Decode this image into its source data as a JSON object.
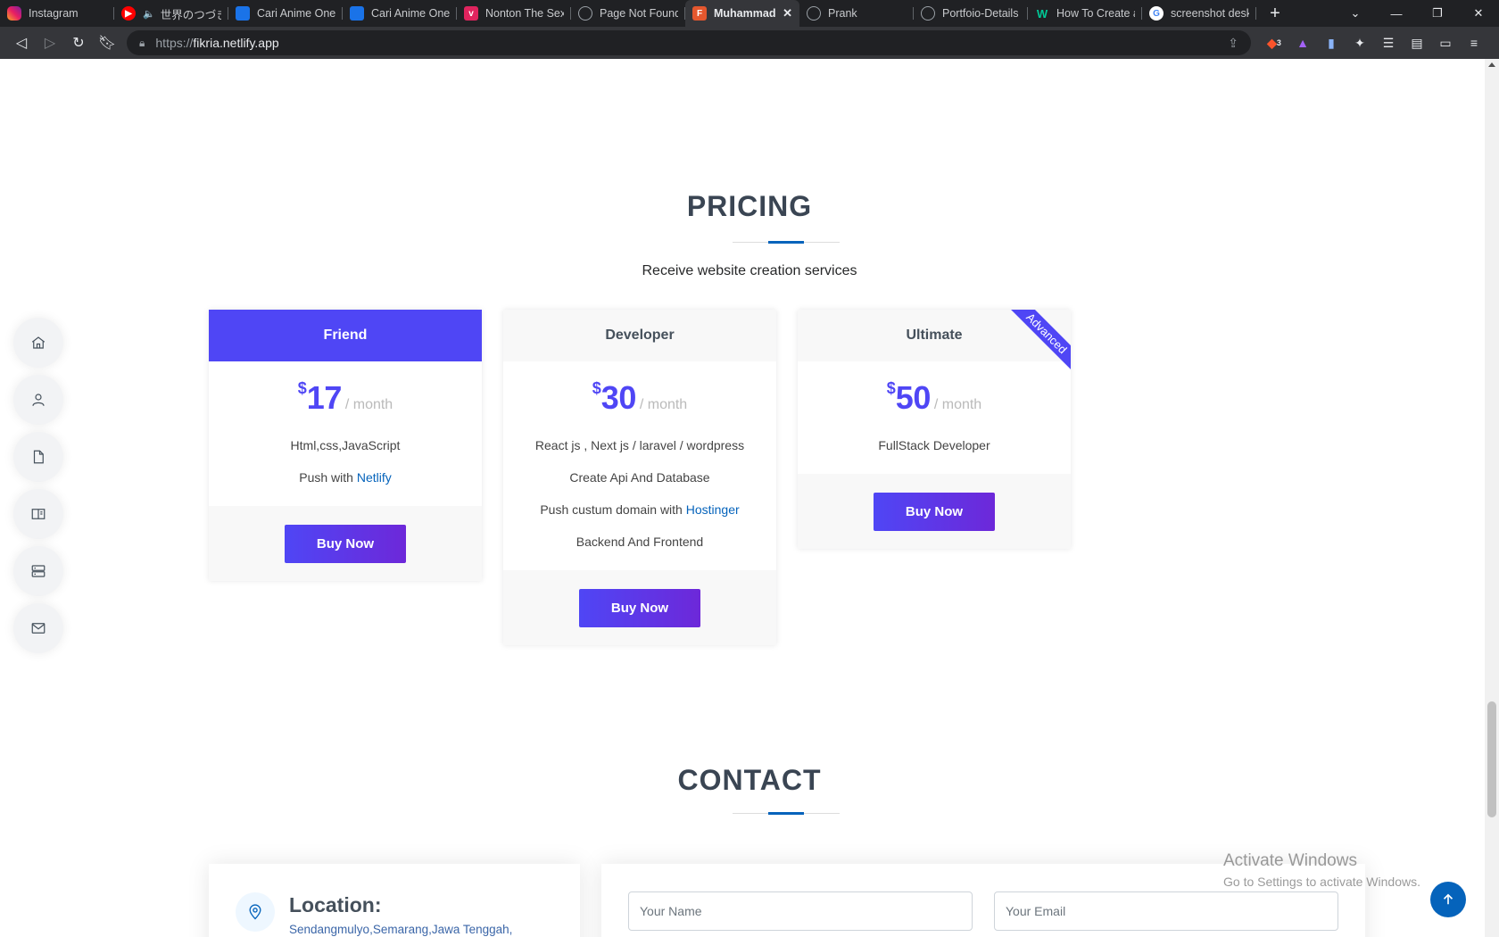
{
  "browser": {
    "tabs": [
      {
        "title": "Instagram",
        "icon": "instagram-icon"
      },
      {
        "title": "世界のつづき -",
        "icon": "youtube-icon"
      },
      {
        "title": "Cari Anime One F",
        "icon": "anime-icon"
      },
      {
        "title": "Cari Anime One F",
        "icon": "anime-icon"
      },
      {
        "title": "Nonton The Sexy",
        "icon": "nonton-icon"
      },
      {
        "title": "Page Not Found",
        "icon": "globe-icon"
      },
      {
        "title": "Muhammad Fi",
        "icon": "fikri-icon"
      },
      {
        "title": "Prank",
        "icon": "globe-icon"
      },
      {
        "title": "Portfoio-Details",
        "icon": "globe-icon"
      },
      {
        "title": "How To Create a",
        "icon": "w-icon"
      },
      {
        "title": "screenshot deskt",
        "icon": "google-icon"
      }
    ],
    "url_prefix": "https://",
    "url_host": "fikria.netlify.app",
    "brave_badge": "3"
  },
  "sidebar": {
    "items": [
      "home-icon",
      "person-icon",
      "file-icon",
      "book-icon",
      "server-icon",
      "mail-icon"
    ]
  },
  "pricing": {
    "title": "PRICING",
    "subtitle": "Receive website creation services",
    "plans": [
      {
        "name": "Friend",
        "currency": "$",
        "amount": "17",
        "period": "/ month",
        "features": [
          "Html,css,JavaScript"
        ],
        "feature_link_prefix": "Push with ",
        "feature_link": "Netlify",
        "button": "Buy Now"
      },
      {
        "name": "Developer",
        "currency": "$",
        "amount": "30",
        "period": "/ month",
        "features": [
          "React js , Next js / laravel / wordpress",
          "Create Api And Database",
          "Backend And Frontend"
        ],
        "feature_link_prefix": "Push custum domain with ",
        "feature_link": "Hostinger",
        "button": "Buy Now"
      },
      {
        "name": "Ultimate",
        "currency": "$",
        "amount": "50",
        "period": "/ month",
        "features": [
          "FullStack Developer"
        ],
        "ribbon": "Advanced",
        "button": "Buy Now"
      }
    ]
  },
  "contact": {
    "title": "CONTACT",
    "location_heading": "Location:",
    "location_text": "Sendangmulyo,Semarang,Jawa Tenggah,",
    "name_placeholder": "Your Name",
    "email_placeholder": "Your Email"
  },
  "watermark": {
    "line1": "Activate Windows",
    "line2": "Go to Settings to activate Windows."
  },
  "colors": {
    "accent": "#4f46f5",
    "link": "#0563bb"
  }
}
